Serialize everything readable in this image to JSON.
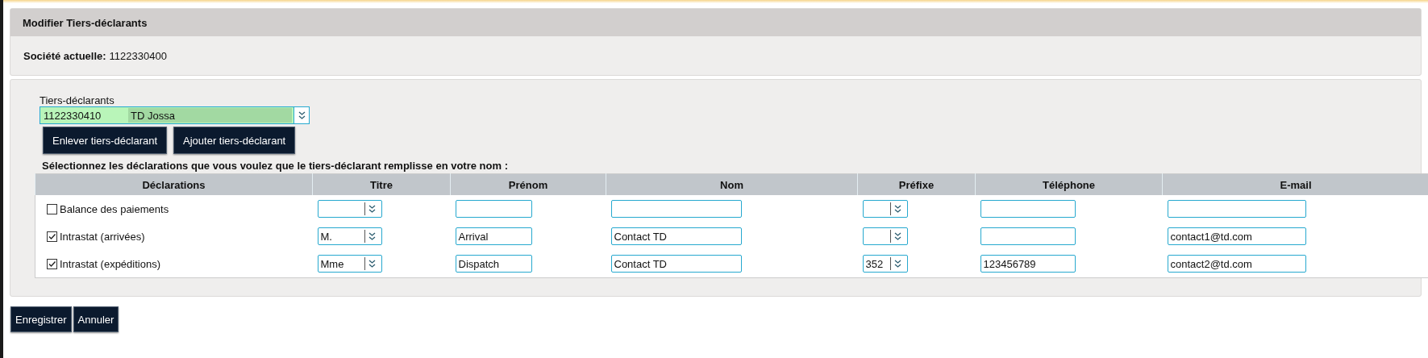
{
  "panel_title": "Modifier Tiers-déclarants",
  "current_company": {
    "label": "Société actuelle:",
    "value": "1122330400"
  },
  "declarant_select": {
    "label": "Tiers-déclarants",
    "code": "1122330410",
    "name": "TD Jossa"
  },
  "declarant_buttons": [
    "Enlever tiers-déclarant",
    "Ajouter tiers-déclarant"
  ],
  "instruction": "Sélectionnez les déclarations que vous voulez que le tiers-déclarant remplisse en votre nom :",
  "table": {
    "columns": [
      "Déclarations",
      "Titre",
      "Prénom",
      "Nom",
      "Préfixe",
      "Téléphone",
      "E-mail"
    ],
    "rows": [
      {
        "declaration": "Balance des paiements",
        "checked": false
      },
      {
        "declaration": "Intrastat (arrivées)",
        "checked": true,
        "title": "M.",
        "first_name": "Arrival",
        "last_name": "Contact TD",
        "email": "contact1@td.com"
      },
      {
        "declaration": "Intrastat (expéditions)",
        "checked": true,
        "title": "Mme",
        "first_name": "Dispatch",
        "last_name": "Contact TD",
        "prefix": "352",
        "phone": "123456789",
        "email": "contact2@td.com"
      }
    ]
  },
  "footer_buttons": [
    "Enregistrer",
    "Annuler"
  ]
}
